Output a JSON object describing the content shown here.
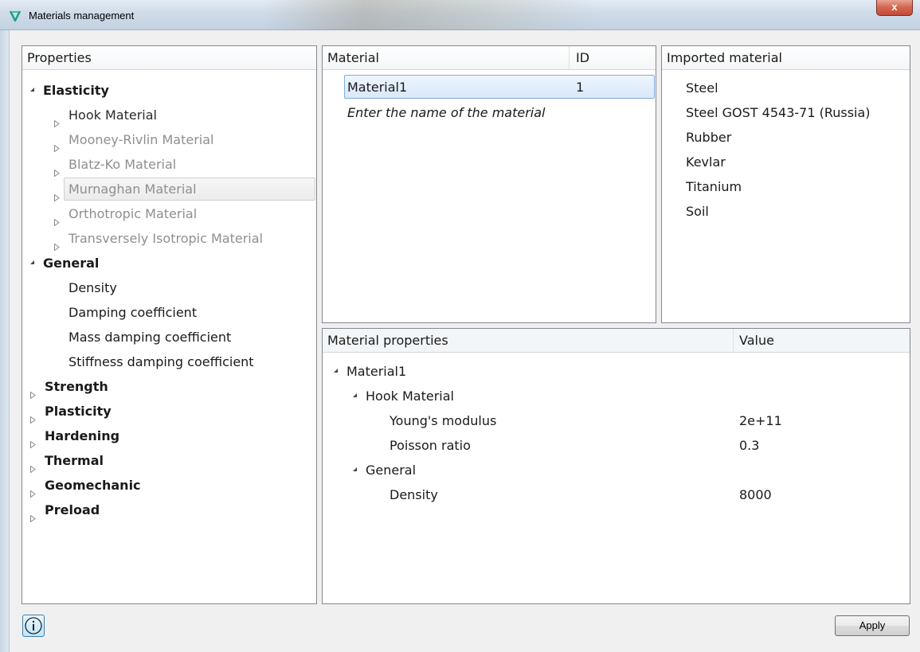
{
  "window": {
    "title": "Materials management",
    "close_label": "x"
  },
  "properties_panel": {
    "header": "Properties",
    "tree": [
      {
        "label": "Elasticity",
        "bold": true,
        "expanded": true,
        "level": 0
      },
      {
        "label": "Hook Material",
        "level": 1,
        "enabled": true
      },
      {
        "label": "Mooney-Rivlin Material",
        "level": 1,
        "enabled": false
      },
      {
        "label": "Blatz-Ko Material",
        "level": 1,
        "enabled": false
      },
      {
        "label": "Murnaghan Material",
        "level": 1,
        "enabled": false,
        "hover": true
      },
      {
        "label": "Orthotropic Material",
        "level": 1,
        "enabled": false
      },
      {
        "label": "Transversely Isotropic Material",
        "level": 1,
        "enabled": false
      },
      {
        "label": "General",
        "bold": true,
        "expanded": true,
        "level": 0
      },
      {
        "label": "Density",
        "level": 2
      },
      {
        "label": "Damping coefficient",
        "level": 2
      },
      {
        "label": "Mass damping coefficient",
        "level": 2
      },
      {
        "label": "Stiffness damping coefficient",
        "level": 2
      },
      {
        "label": "Strength",
        "bold": true,
        "expanded": false,
        "level": 0
      },
      {
        "label": "Plasticity",
        "bold": true,
        "expanded": false,
        "level": 0
      },
      {
        "label": "Hardening",
        "bold": true,
        "expanded": false,
        "level": 0
      },
      {
        "label": "Thermal",
        "bold": true,
        "expanded": false,
        "level": 0
      },
      {
        "label": "Geomechanic",
        "bold": true,
        "expanded": false,
        "level": 0
      },
      {
        "label": "Preload",
        "bold": true,
        "expanded": false,
        "level": 0
      }
    ]
  },
  "material_panel": {
    "col_material": "Material",
    "col_id": "ID",
    "rows": [
      {
        "name": "Material1",
        "id": "1"
      }
    ],
    "placeholder": "Enter the name of the material"
  },
  "imported_panel": {
    "header": "Imported material",
    "items": [
      "Steel",
      "Steel GOST 4543-71 (Russia)",
      "Rubber",
      "Kevlar",
      "Titanium",
      "Soil"
    ]
  },
  "properties_table": {
    "col_property": "Material properties",
    "col_value": "Value",
    "rows": [
      {
        "label": "Material1",
        "value": "",
        "level": 0,
        "expander": true
      },
      {
        "label": "Hook Material",
        "value": "",
        "level": 1,
        "expander": true
      },
      {
        "label": "Young's modulus",
        "value": "2e+11",
        "level": 2,
        "expander": false
      },
      {
        "label": "Poisson ratio",
        "value": "0.3",
        "level": 2,
        "expander": false
      },
      {
        "label": "General",
        "value": "",
        "level": 1,
        "expander": true
      },
      {
        "label": "Density",
        "value": "8000",
        "level": 2,
        "expander": false
      }
    ]
  },
  "footer": {
    "apply_label": "Apply",
    "info_icon": "info-icon"
  }
}
